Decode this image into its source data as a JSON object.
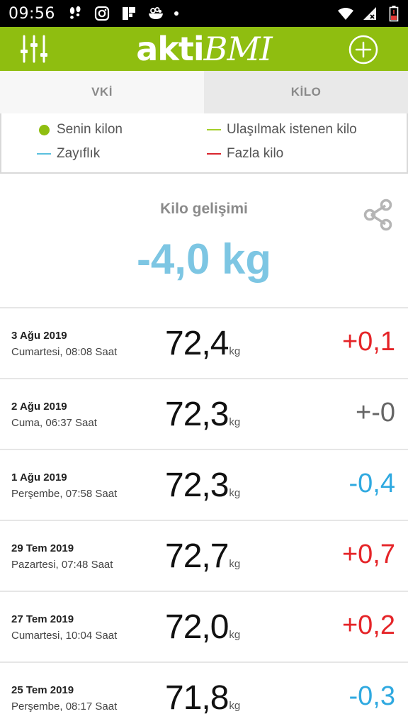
{
  "status_bar": {
    "time": "09:56",
    "left_icons": [
      "footsteps-icon",
      "instagram-icon",
      "flipboard-icon",
      "food-bowl-icon",
      "dot-icon"
    ],
    "right_icons": [
      "wifi-icon",
      "cell-signal-icon",
      "battery-low-icon"
    ]
  },
  "app_bar": {
    "logo_part1": "akti",
    "logo_part2": "BMI",
    "menu_icon": "sliders-icon",
    "add_icon": "add-circle-icon",
    "color": "#8fbe10"
  },
  "tabs": [
    {
      "label": "VKİ",
      "selected": false
    },
    {
      "label": "KİLO",
      "selected": true
    }
  ],
  "legend": {
    "items": [
      {
        "label": "Senin kilon",
        "type": "dot",
        "color": "#8fbe10"
      },
      {
        "label": "Zayıflık",
        "type": "line",
        "color": "#5bc0de"
      },
      {
        "label": "Ulaşılmak istenen kilo",
        "type": "line",
        "color": "#a4cf2a"
      },
      {
        "label": "Fazla kilo",
        "type": "line",
        "color": "#d9262e"
      }
    ]
  },
  "summary": {
    "title": "Kilo gelişimi",
    "value": "-4,0 kg",
    "value_color": "#7dc6e3",
    "share_icon": "share-icon"
  },
  "history": [
    {
      "date": "3 Ağu 2019",
      "time": "Cumartesi, 08:08 Saat",
      "weight": "72,4",
      "unit": "kg",
      "change": "+0,1",
      "change_color": "#e52428"
    },
    {
      "date": "2 Ağu 2019",
      "time": "Cuma, 06:37 Saat",
      "weight": "72,3",
      "unit": "kg",
      "change": "+-0",
      "change_color": "#666666"
    },
    {
      "date": "1 Ağu 2019",
      "time": "Perşembe, 07:58 Saat",
      "weight": "72,3",
      "unit": "kg",
      "change": "-0,4",
      "change_color": "#2fa9e0"
    },
    {
      "date": "29 Tem 2019",
      "time": "Pazartesi, 07:48 Saat",
      "weight": "72,7",
      "unit": "kg",
      "change": "+0,7",
      "change_color": "#e52428"
    },
    {
      "date": "27 Tem 2019",
      "time": "Cumartesi, 10:04 Saat",
      "weight": "72,0",
      "unit": "kg",
      "change": "+0,2",
      "change_color": "#e52428"
    },
    {
      "date": "25 Tem 2019",
      "time": "Perşembe, 08:17 Saat",
      "weight": "71,8",
      "unit": "kg",
      "change": "-0,3",
      "change_color": "#2fa9e0"
    }
  ]
}
